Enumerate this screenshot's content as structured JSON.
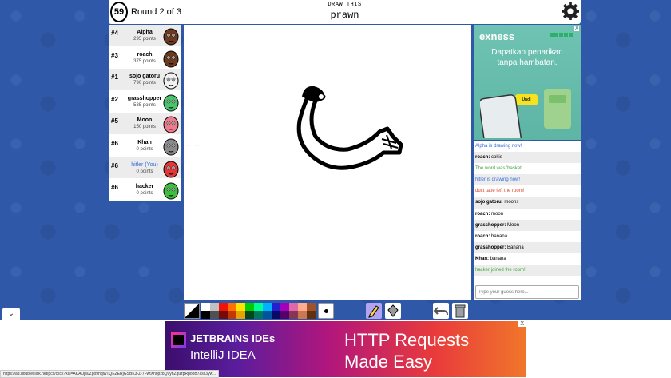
{
  "header": {
    "timer": "59",
    "round_text": "Round 2 of 3",
    "hint_label": "DRAW THIS",
    "word": "prawn"
  },
  "players": [
    {
      "rank": "#4",
      "name": "Alpha",
      "points": "295 points",
      "avatar_color": "#6b3a1f",
      "you": false
    },
    {
      "rank": "#3",
      "name": "roach",
      "points": "375 points",
      "avatar_color": "#6b3a1f",
      "you": false
    },
    {
      "rank": "#1",
      "name": "sojo gatoru",
      "points": "790 points",
      "avatar_color": "#f1f1f1",
      "you": false
    },
    {
      "rank": "#2",
      "name": "grasshopper",
      "points": "535 points",
      "avatar_color": "#49c46b",
      "you": false
    },
    {
      "rank": "#5",
      "name": "Moon",
      "points": "150 points",
      "avatar_color": "#f07a8c",
      "you": false
    },
    {
      "rank": "#6",
      "name": "Khan",
      "points": "0 points",
      "avatar_color": "#8a8a8a",
      "you": false
    },
    {
      "rank": "#6",
      "name": "hitler (You)",
      "points": "0 points",
      "avatar_color": "#e0373a",
      "you": true
    },
    {
      "rank": "#6",
      "name": "hacker",
      "points": "0 points",
      "avatar_color": "#3fbf3f",
      "you": false
    }
  ],
  "side_ad": {
    "brand": "exness",
    "tagline_1": "Dapatkan penarikan",
    "tagline_2": "tanpa hambatan.",
    "button": "Undi",
    "close": "X"
  },
  "chat": {
    "messages": [
      {
        "name": "",
        "text": "Alpha is drawing now!",
        "color": "#3a6fd8"
      },
      {
        "name": "roach:",
        "text": "cokie",
        "color": "#000000"
      },
      {
        "name": "",
        "text": "The word was 'basket'",
        "color": "#3aa83a"
      },
      {
        "name": "",
        "text": "hitler is drawing now!",
        "color": "#3a6fd8"
      },
      {
        "name": "",
        "text": "duct tape left the room!",
        "color": "#d84a2a"
      },
      {
        "name": "sojo gatoru:",
        "text": "moons",
        "color": "#000000"
      },
      {
        "name": "roach:",
        "text": "moon",
        "color": "#000000"
      },
      {
        "name": "grasshopper:",
        "text": "Moon",
        "color": "#000000"
      },
      {
        "name": "roach:",
        "text": "banana",
        "color": "#000000"
      },
      {
        "name": "grasshopper:",
        "text": "Banana",
        "color": "#000000"
      },
      {
        "name": "Khan:",
        "text": "banana",
        "color": "#000000"
      },
      {
        "name": "",
        "text": "hacker joined the room!",
        "color": "#3aa83a"
      }
    ],
    "input_placeholder": "Type your guess here..."
  },
  "palette": {
    "row1": [
      "#ffffff",
      "#c1c1c1",
      "#ef130b",
      "#ff7100",
      "#ffe400",
      "#00cc00",
      "#00ff91",
      "#00b2ff",
      "#231fd3",
      "#a300ba",
      "#df69a7",
      "#ffac8e",
      "#a0522d"
    ],
    "row2": [
      "#000000",
      "#505050",
      "#740b07",
      "#c23800",
      "#e8a200",
      "#004619",
      "#00785d",
      "#00569e",
      "#0e0865",
      "#550069",
      "#873554",
      "#cc774d",
      "#63300d"
    ]
  },
  "bottom_ad": {
    "line1": "JETBRAINS IDEs",
    "line2": "IntelliJ IDEA",
    "headline1": "HTTP Requests",
    "headline2": "Made Easy",
    "close": "X"
  },
  "status_url": "https://ad.doubleclick.net/pcs/click?xai=AKAOjsuZgo9hqlwTQEZERjGSBK3-Z-7FwtXnopz8Q9yhZguzpRpo8B7ass3yw..."
}
